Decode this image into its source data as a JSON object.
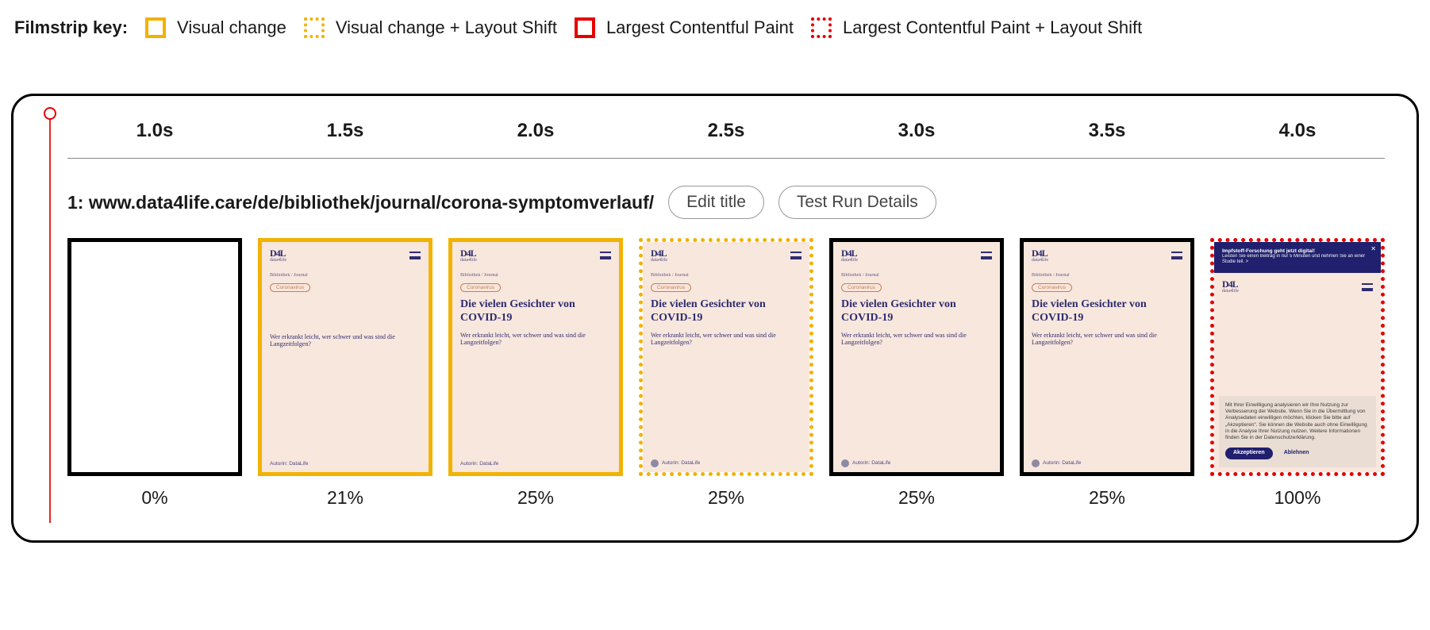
{
  "key": {
    "label": "Filmstrip key:",
    "items": [
      {
        "label": "Visual change"
      },
      {
        "label": "Visual change + Layout Shift"
      },
      {
        "label": "Largest Contentful Paint"
      },
      {
        "label": "Largest Contentful Paint + Layout Shift"
      }
    ]
  },
  "filmstrip": {
    "times": [
      "1.0s",
      "1.5s",
      "2.0s",
      "2.5s",
      "3.0s",
      "3.5s",
      "4.0s"
    ],
    "title_prefix": "1: ",
    "url": "www.data4life.care/de/bibliothek/journal/corona-symptomverlauf/",
    "edit_title_label": "Edit title",
    "details_label": "Test Run Details",
    "percentages": [
      "0%",
      "21%",
      "25%",
      "25%",
      "25%",
      "25%",
      "100%"
    ]
  },
  "thumb": {
    "logo": "D4L",
    "sublogo": "data4life",
    "crumbs": "Bibliothek / Journal",
    "tag": "Coronavirus",
    "headline": "Die vielen Gesichter von COVID-19",
    "sub_full": "Wer erkrankt leicht, wer schwer und was sind die Langzeitfolgen?",
    "byline_noavatar": "Autorin: DataLife",
    "byline_avatar": "Autorin: DataLife",
    "banner_line1": "Impfstoff-Forschung geht jetzt digital!",
    "banner_line2": "Leisten Sie einen Beitrag in nur 5 Minuten und nehmen Sie an einer Studie teil. >",
    "banner_close": "✕",
    "cookie_text": "Mit Ihrer Einwilligung analysieren wir Ihre Nutzung zur Verbesserung der Website. Wenn Sie in die Übermittlung von Analysedaten einwilligen möchten, klicken Sie bitte auf „Akzeptieren“. Sie können die Website auch ohne Einwilligung in die Analyse Ihrer Nutzung nutzen. Weitere Informationen finden Sie in der Datenschutzerklärung.",
    "cookie_accept": "Akzeptieren",
    "cookie_decline": "Ablehnen"
  }
}
